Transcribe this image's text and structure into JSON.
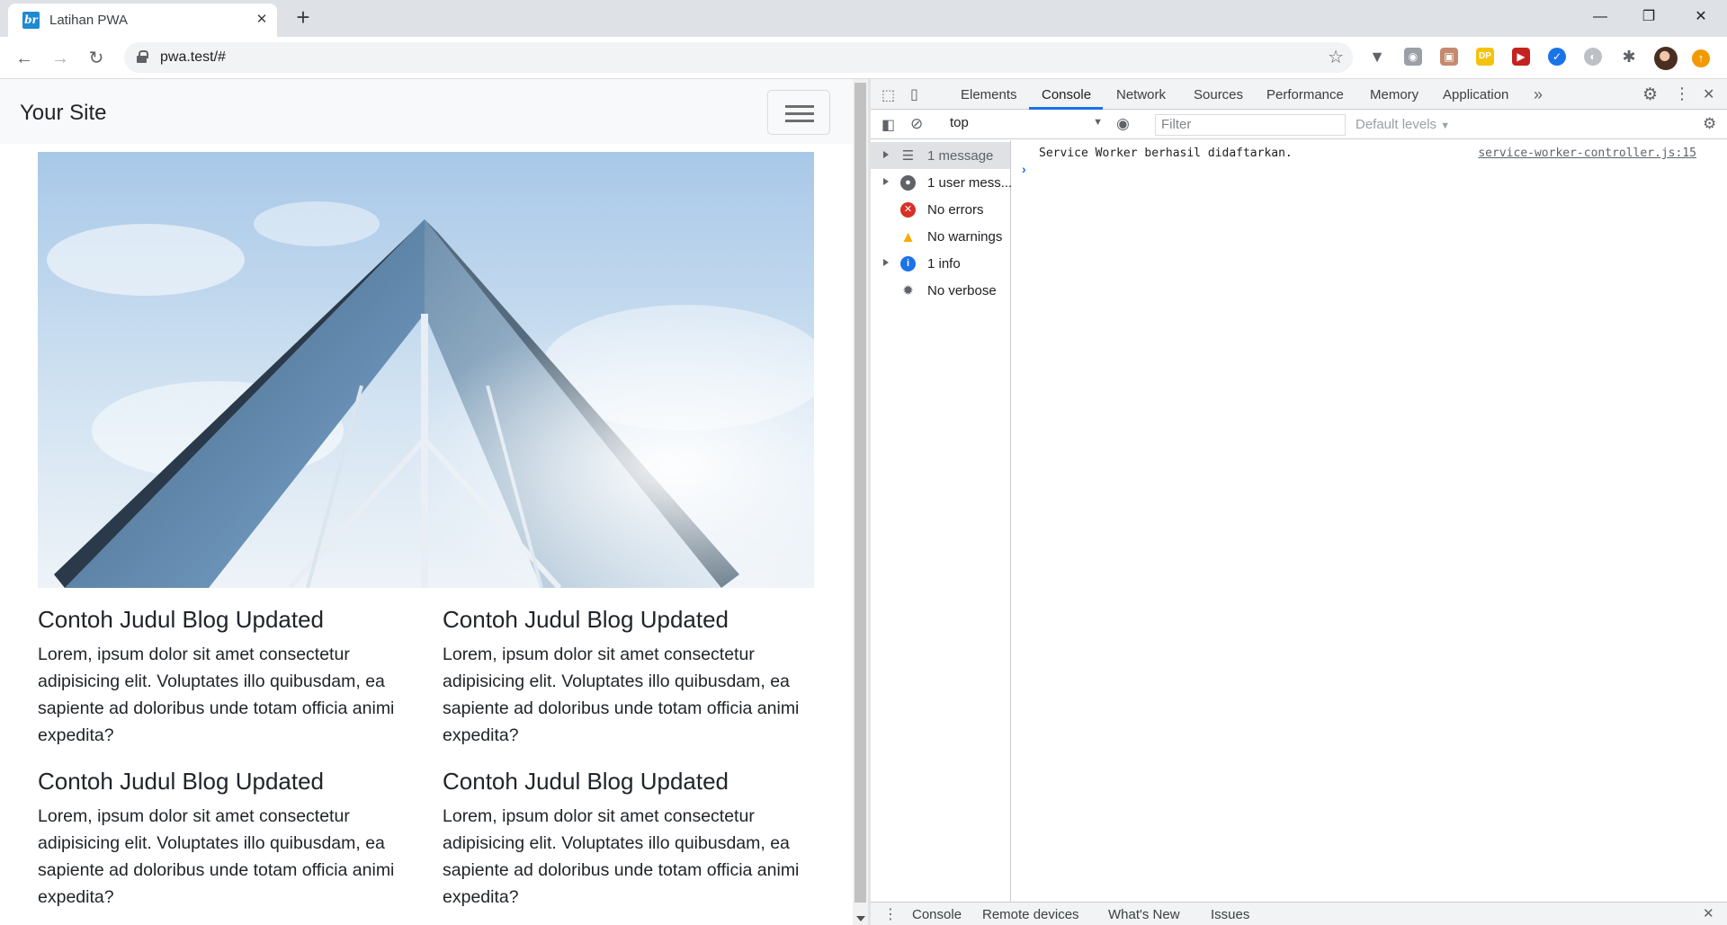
{
  "browser": {
    "tab_title": "Latihan PWA",
    "favicon_text": "br",
    "url": "pwa.test/#"
  },
  "page": {
    "brand": "Your Site",
    "posts": [
      {
        "title": "Contoh Judul Blog Updated",
        "body": "Lorem, ipsum dolor sit amet consectetur adipisicing elit. Voluptates illo quibusdam, ea sapiente ad doloribus unde totam officia animi expedita?"
      },
      {
        "title": "Contoh Judul Blog Updated",
        "body": "Lorem, ipsum dolor sit amet consectetur adipisicing elit. Voluptates illo quibusdam, ea sapiente ad doloribus unde totam officia animi expedita?"
      },
      {
        "title": "Contoh Judul Blog Updated",
        "body": "Lorem, ipsum dolor sit amet consectetur adipisicing elit. Voluptates illo quibusdam, ea sapiente ad doloribus unde totam officia animi expedita?"
      },
      {
        "title": "Contoh Judul Blog Updated",
        "body": "Lorem, ipsum dolor sit amet consectetur adipisicing elit. Voluptates illo quibusdam, ea sapiente ad doloribus unde totam officia animi expedita?"
      }
    ]
  },
  "devtools": {
    "tabs": [
      "Elements",
      "Console",
      "Network",
      "Sources",
      "Performance",
      "Memory",
      "Application"
    ],
    "active_tab": "Console",
    "context": "top",
    "filter_placeholder": "Filter",
    "levels": "Default levels",
    "sidebar": [
      {
        "label": "1 message",
        "icon": "list-icon"
      },
      {
        "label": "1 user mess...",
        "icon": "user-icon"
      },
      {
        "label": "No errors",
        "icon": "error-icon"
      },
      {
        "label": "No warnings",
        "icon": "warning-icon"
      },
      {
        "label": "1 info",
        "icon": "info-icon"
      },
      {
        "label": "No verbose",
        "icon": "bug-icon"
      }
    ],
    "log": {
      "message": "Service Worker berhasil didaftarkan.",
      "source": "service-worker-controller.js:15"
    },
    "drawer_tabs": [
      "Console",
      "Remote devices",
      "What's New",
      "Issues"
    ]
  },
  "colors": {
    "accent": "#1a73e8",
    "error": "#d93025",
    "warning": "#f9ab00",
    "info": "#1a73e8"
  }
}
